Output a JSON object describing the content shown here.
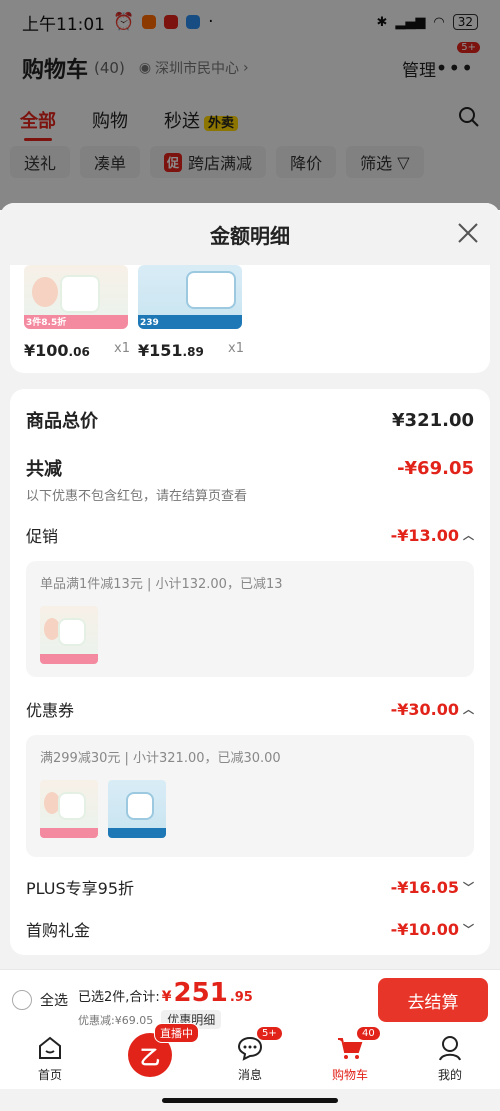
{
  "status_bar": {
    "time": "上午11:01",
    "battery": "32"
  },
  "header": {
    "title": "购物车",
    "count": "(40)",
    "location": "深圳市民中心",
    "manage": "管理",
    "more_badge": "5+"
  },
  "tabs": [
    {
      "label": "全部"
    },
    {
      "label": "购物"
    },
    {
      "label": "秒送",
      "tag": "外卖"
    }
  ],
  "chips": [
    "送礼",
    "凑单",
    "跨店满减",
    "降价",
    "筛选"
  ],
  "chip_tag": "促",
  "sheet": {
    "title": "金额明细",
    "products": [
      {
        "price_int": "¥100",
        "price_dec": ".06",
        "qty": "x1",
        "thumb_tag": "3件8.5折"
      },
      {
        "price_int": "¥151",
        "price_dec": ".89",
        "qty": "x1",
        "thumb_tag": "239"
      }
    ],
    "total_label": "商品总价",
    "total_value": "¥321.00",
    "reduce_label": "共减",
    "reduce_value": "-¥69.05",
    "reduce_note": "以下优惠不包含红包，请在结算页查看",
    "promo": {
      "label": "促销",
      "value": "-¥13.00",
      "detail": "单品满1件减13元 | 小计132.00，已减13"
    },
    "coupon": {
      "label": "优惠券",
      "value": "-¥30.00",
      "detail": "满299减30元 | 小计321.00，已减30.00"
    },
    "plus": {
      "label": "PLUS专享95折",
      "value": "-¥16.05"
    },
    "first": {
      "label": "首购礼金",
      "value": "-¥10.00"
    }
  },
  "checkout": {
    "select_all": "全选",
    "selected_text": "已选2件,合计:",
    "total_sym": "¥",
    "total_int": "251",
    "total_dec": ".95",
    "discount_text": "优惠减:¥69.05",
    "detail_btn": "优惠明细",
    "pay_btn": "去结算"
  },
  "tabbar": [
    {
      "label": "首页"
    },
    {
      "label": "",
      "tag": "直播中"
    },
    {
      "label": "消息",
      "badge": "5+"
    },
    {
      "label": "购物车",
      "badge": "40"
    },
    {
      "label": "我的"
    }
  ],
  "colors": {
    "accent": "#e2231a",
    "pay": "#e8352a",
    "sheet_bg": "#f2f2f2"
  }
}
